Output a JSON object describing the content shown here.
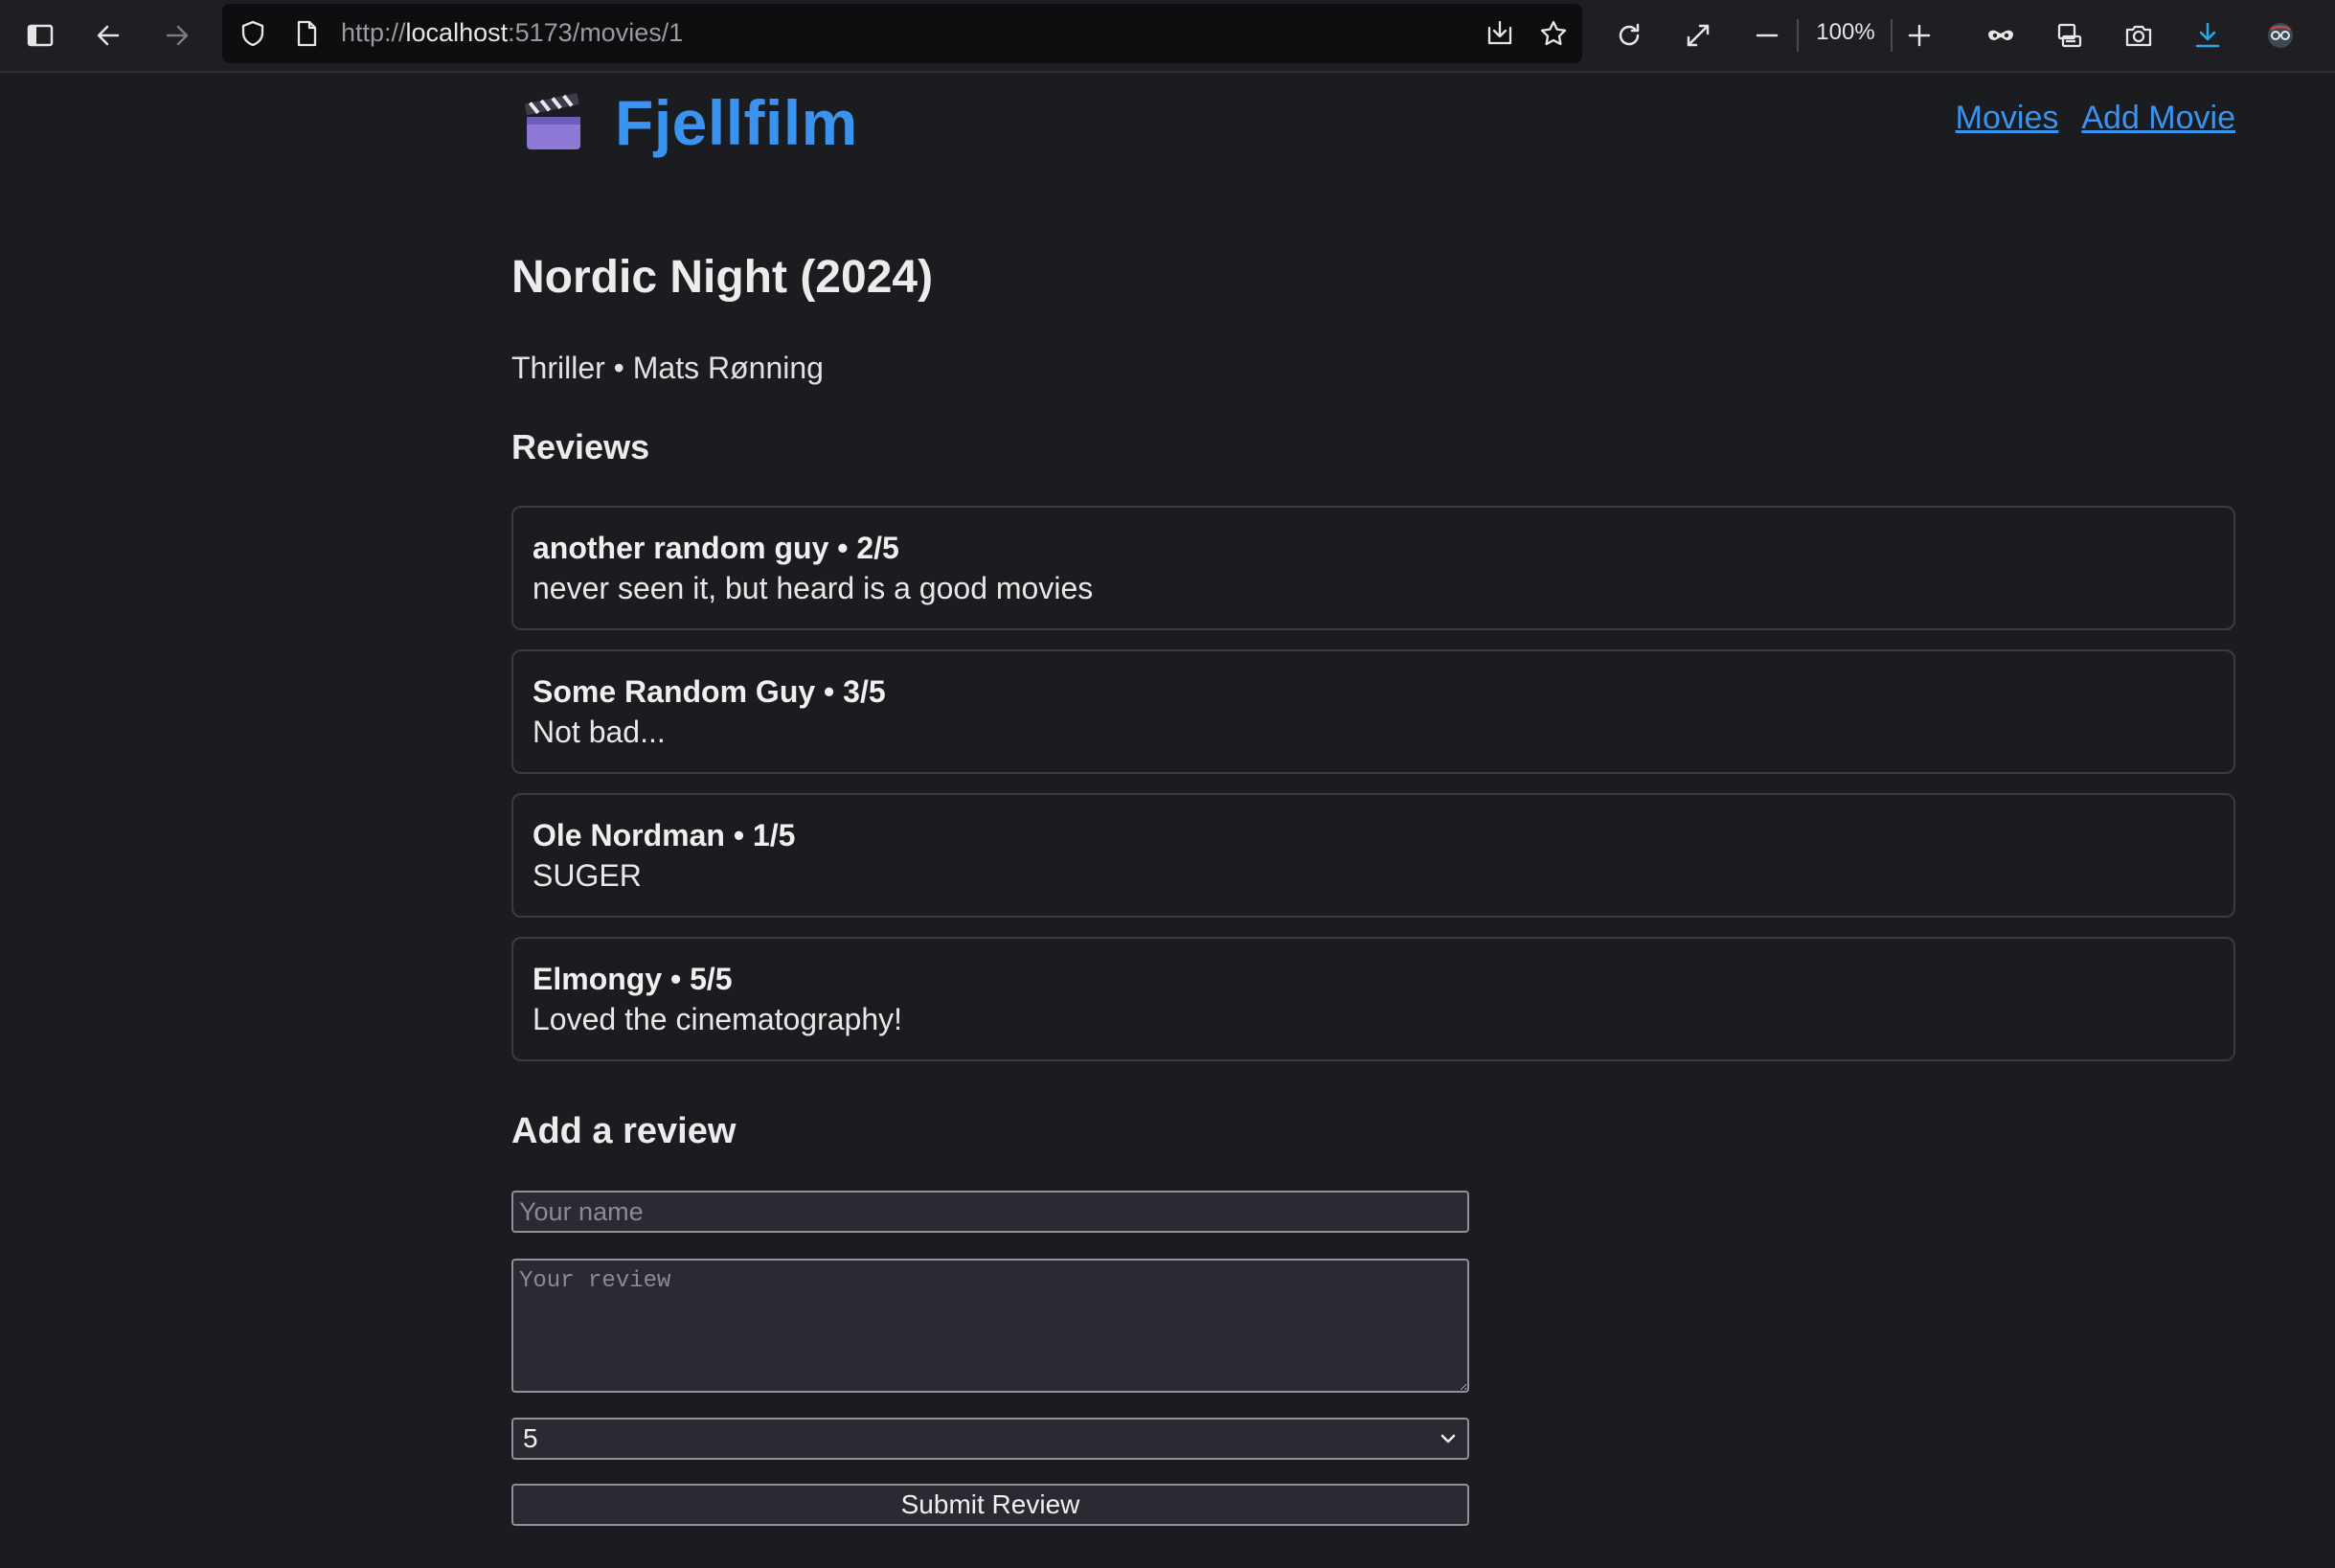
{
  "browser": {
    "url_prefix": "http://",
    "url_host": "localhost",
    "url_path": ":5173/movies/1",
    "zoom": "100%"
  },
  "brand": {
    "name": "Fjellfilm",
    "icon": "clapperboard-icon"
  },
  "nav": {
    "movies": "Movies",
    "add_movie": "Add Movie"
  },
  "movie": {
    "title": "Nordic Night (2024)",
    "meta": "Thriller • Mats Rønning"
  },
  "reviews_heading": "Reviews",
  "reviews": [
    {
      "header": "another random guy • 2/5",
      "text": "never seen it, but heard is a good movies"
    },
    {
      "header": "Some Random Guy • 3/5",
      "text": "Not bad..."
    },
    {
      "header": "Ole Nordman • 1/5",
      "text": "SUGER"
    },
    {
      "header": "Elmongy • 5/5",
      "text": "Loved the cinematography!"
    }
  ],
  "form": {
    "heading": "Add a review",
    "name_placeholder": "Your name",
    "review_placeholder": "Your review",
    "rating_value": "5",
    "submit_label": "Submit Review"
  },
  "colors": {
    "accent": "#3b93f0",
    "background": "#1b1c1f",
    "download_icon": "#2ba8e6"
  }
}
